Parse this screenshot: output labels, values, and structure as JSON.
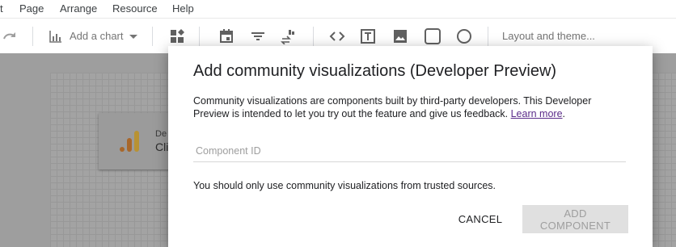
{
  "menu": {
    "items": [
      "t",
      "Page",
      "Arrange",
      "Resource",
      "Help"
    ]
  },
  "toolbar": {
    "add_chart_label": "Add a chart",
    "layout_theme_label": "Layout and theme...",
    "icons": [
      "redo-icon",
      "bar-chart-icon",
      "chevron-down-icon",
      "community-viz-icon",
      "calendar-icon",
      "filter-icon",
      "data-control-icon",
      "code-icon",
      "text-box-icon",
      "image-icon",
      "rectangle-icon",
      "circle-icon"
    ]
  },
  "canvas": {
    "scorecard": {
      "label_small": "De",
      "label_big": "Cli"
    },
    "logo_colors": [
      "#E37400",
      "#F9AB00"
    ]
  },
  "dialog": {
    "title": "Add community visualizations (Developer Preview)",
    "description": "Community visualizations are components built by third-party developers. This Developer Preview is intended to let you try out the feature and give us feedback.",
    "learn_more": "Learn more",
    "learn_more_suffix": ".",
    "input_placeholder": "Component ID",
    "input_value": "",
    "warning": "You should only use community visualizations from trusted sources.",
    "cancel_label": "CANCEL",
    "add_label": "ADD COMPONENT"
  }
}
